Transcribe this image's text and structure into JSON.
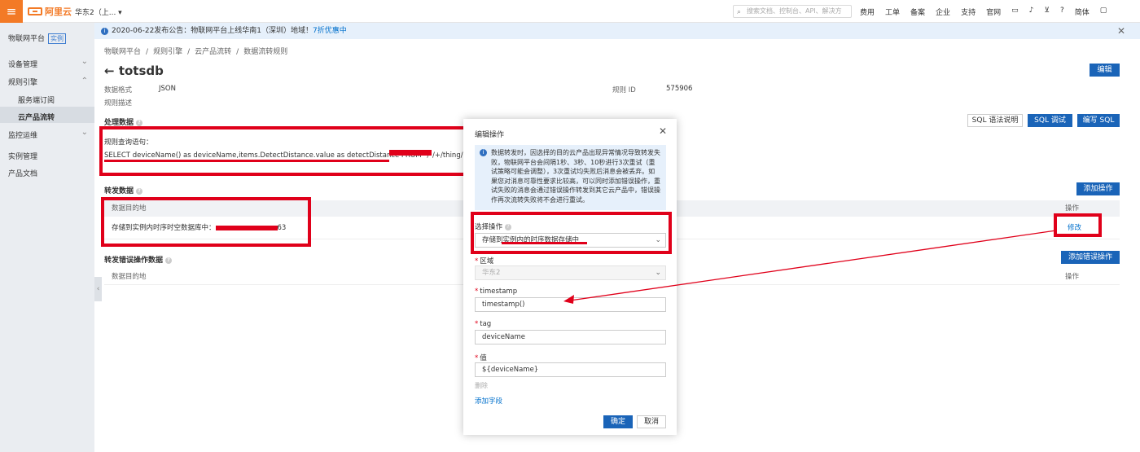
{
  "topbar": {
    "brand": "阿里云",
    "region": "华东2（上...",
    "search_placeholder": "搜索文档、控制台、API、解决方",
    "nav": [
      "费用",
      "工单",
      "备案",
      "企业",
      "支持",
      "官网"
    ],
    "lang": "简体"
  },
  "sidebar": {
    "title": "物联网平台",
    "tag": "实例",
    "items": [
      "设备管理",
      "规则引擎",
      "服务端订阅",
      "云产品流转",
      "监控运维",
      "实例管理",
      "产品文档"
    ]
  },
  "notice": {
    "text": "2020-06-22发布公告：物联网平台上线华南1（深圳）地域！",
    "link": "7折优惠中"
  },
  "breadcrumb": [
    "物联网平台",
    "/",
    "规则引擎",
    "/",
    "云产品流转",
    "/",
    "数据流转规则"
  ],
  "page": {
    "back": "←",
    "title": "totsdb",
    "edit_button": "编辑",
    "format_label": "数据格式",
    "format_value": "JSON",
    "desc_label": "规则描述",
    "rule_id_label": "规则 ID",
    "rule_id_value": "575906"
  },
  "processing": {
    "section": "处理数据",
    "sql_help_button": "SQL 语法说明",
    "sql_debug_button": "SQL 调试",
    "sql_write_button": "编写 SQL",
    "query_label": "规则查询语句：",
    "query_value": "SELECT deviceName() as deviceName,items.DetectDistance.value as detectDistance FROM \"/",
    "query_tail": "/+/thing/e"
  },
  "forward": {
    "section": "转发数据",
    "add_button": "添加操作",
    "col_target": "数据目的地",
    "col_op": "操作",
    "row_text": "存储到实例内时序时空数据库中：",
    "row_tail": "63",
    "row_action": "修改"
  },
  "error_forward": {
    "section": "转发错误操作数据",
    "add_button": "添加错误操作",
    "col_target": "数据目的地",
    "col_op": "操作"
  },
  "modal": {
    "title": "编辑操作",
    "alert": "数据转发时，因选择的目的云产品出现异常情况导致转发失败，物联网平台会间隔1秒、3秒、10秒进行3次重试（重试策略可能会调整），3次重试均失败后消息会被丢弃。如果您对消息可靠性要求比较高，可以同时添加错误操作，重试失败的消息会通过错误操作转发到其它云产品中，错误操作再次流转失败将不会进行重试。",
    "action_label": "选择操作",
    "action_value": "存储到实例内的时序数据存储中",
    "region_label": "区域",
    "region_value": "华东2",
    "timestamp_label": "timestamp",
    "timestamp_value": "timestamp()",
    "tag_label": "tag",
    "tag_value": "deviceName",
    "value_label": "值",
    "value_value": "${deviceName}",
    "delete_link": "删除",
    "add_field_link": "添加字段",
    "ok_button": "确定",
    "cancel_button": "取消"
  },
  "colors": {
    "accent": "#1a64b8",
    "brand": "#f37a26",
    "annotation": "#e0001a"
  }
}
